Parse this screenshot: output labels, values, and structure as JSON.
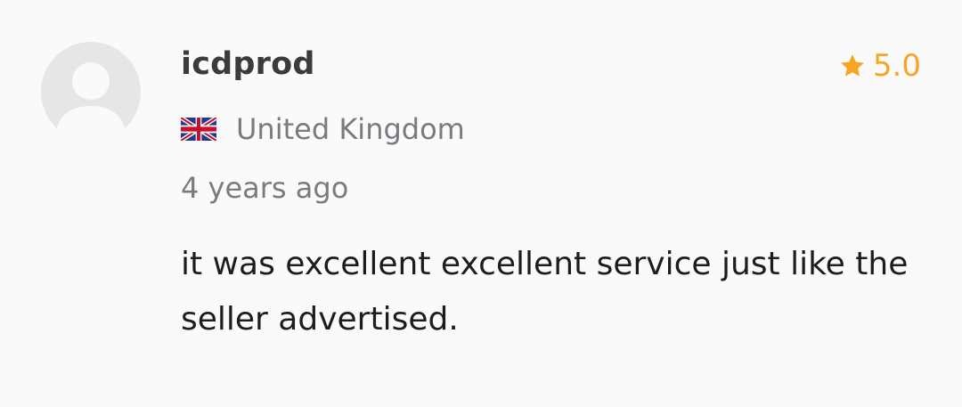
{
  "review": {
    "username": "icdprod",
    "rating": "5.0",
    "country": "United Kingdom",
    "country_flag": "uk-flag",
    "time_ago": "4 years ago",
    "text": "it was excellent excellent service just like the seller advertised."
  },
  "colors": {
    "star": "#f6a623",
    "username": "#3b3b3e",
    "muted": "#7a7a80",
    "body": "#1d1d20",
    "avatar_bg": "#e6e6e8",
    "avatar_fg": "#fafafa"
  },
  "icons": {
    "avatar": "user-silhouette-icon",
    "rating": "star-icon"
  }
}
